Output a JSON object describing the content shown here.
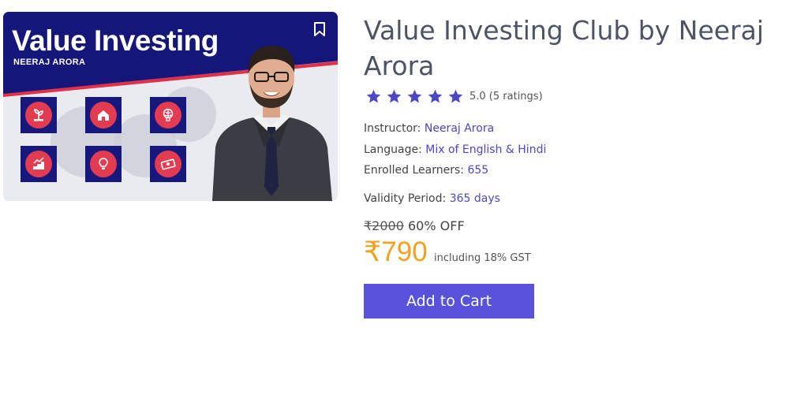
{
  "thumbnail": {
    "title": "Value Investing",
    "subtitle": "NEERAJ ARORA",
    "banner_color": "#14167a",
    "accent_color": "#e0314b",
    "icons": [
      "plant-coins-icon",
      "house-icon",
      "brain-icon",
      "growth-coins-icon",
      "bulb-icon",
      "cash-icon"
    ]
  },
  "course": {
    "title": "Value Investing Club by Neeraj Arora",
    "rating_value": 5,
    "rating_text": "5.0 (5 ratings)",
    "instructor_label": "Instructor:",
    "instructor": "Neeraj Arora",
    "language_label": "Language:",
    "language": "Mix of English & Hindi",
    "learners_label": "Enrolled Learners:",
    "learners": "655",
    "validity_label": "Validity Period:",
    "validity": "365 days"
  },
  "pricing": {
    "old_price": "₹2000",
    "discount": "60% OFF",
    "price": "₹790",
    "gst_note": "including 18% GST",
    "price_color": "#f4a21d"
  },
  "actions": {
    "add_to_cart": "Add to Cart",
    "button_color": "#5752d9"
  },
  "colors": {
    "link": "#4c46c9",
    "star": "#4c46c9"
  }
}
